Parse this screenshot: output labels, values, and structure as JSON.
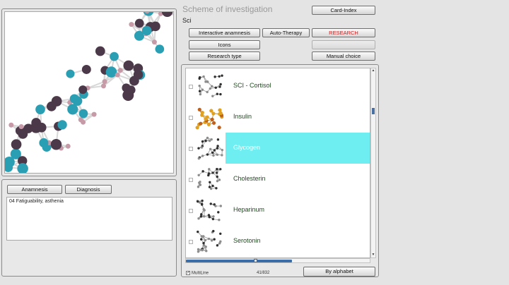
{
  "scheme": {
    "title": "Scheme of investigation",
    "subtitle": "Sci"
  },
  "toolbar": {
    "card_index": "Card-Index",
    "interactive_anamnesis": "Interactive anamnesis",
    "auto_therapy": "Auto-Therapy",
    "research": "RESEARCH",
    "icons": "Icons",
    "research_type": "Research type",
    "manual_choice": "Manual choice"
  },
  "lower": {
    "anamnesis": "Anamnesis",
    "diagnosis": "Diagnosis",
    "note": "04 Fatiguability, asthenia"
  },
  "list": {
    "items": [
      {
        "label": "SCI - Cortisol",
        "selected": false
      },
      {
        "label": "Insulin",
        "selected": false
      },
      {
        "label": "Glycogen",
        "selected": true
      },
      {
        "label": "Cholesterin",
        "selected": false
      },
      {
        "label": "Heparinum",
        "selected": false
      },
      {
        "label": "Serotonin",
        "selected": false
      }
    ],
    "multiline_label": "MultiLine",
    "multiline_checked": true,
    "counter": "41/832",
    "sort_button": "By alphabet"
  },
  "colors": {
    "selection": "#6eeef0",
    "teal_atom": "#2a9fb4",
    "dark_atom": "#4b3848",
    "pink_atom": "#c79aa8"
  }
}
